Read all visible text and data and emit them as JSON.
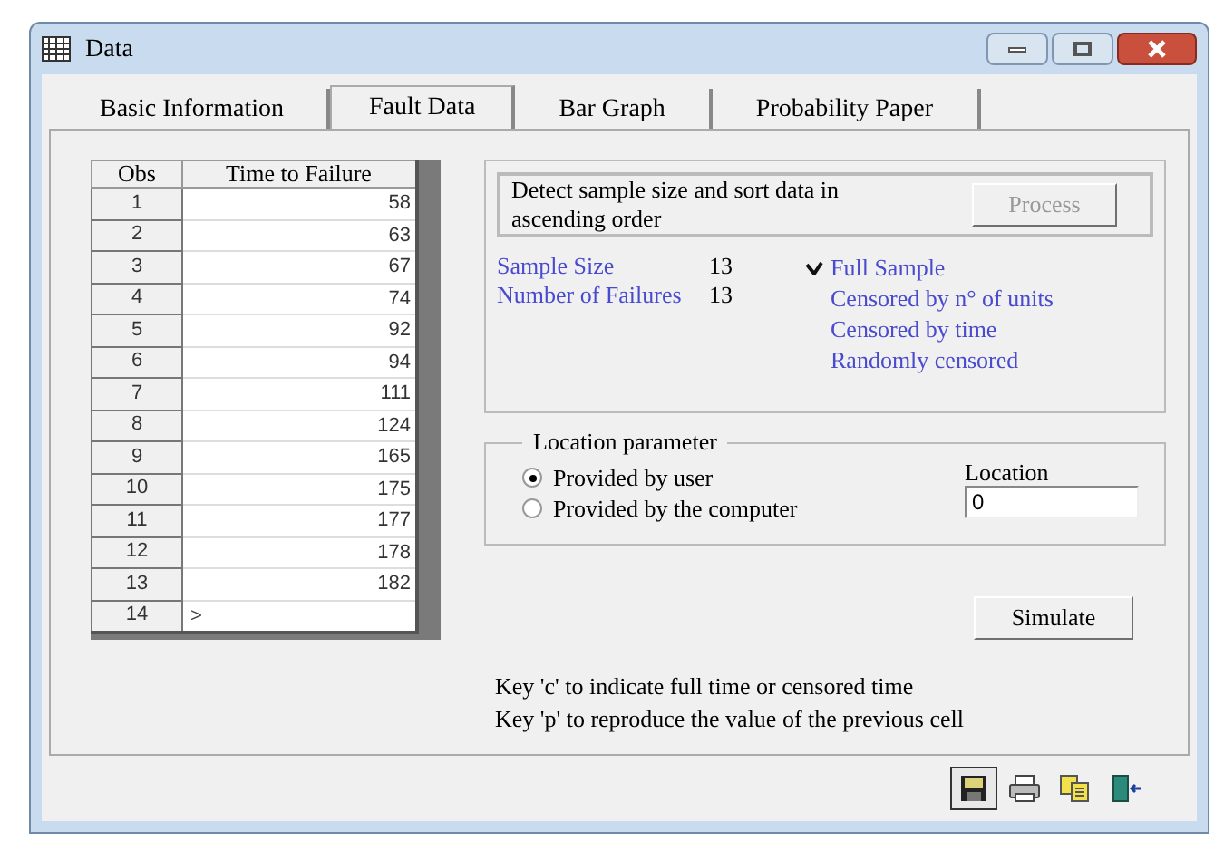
{
  "window": {
    "title": "Data"
  },
  "tabs": [
    {
      "label": "Basic Information",
      "selected": false
    },
    {
      "label": "Fault Data",
      "selected": true
    },
    {
      "label": "Bar Graph",
      "selected": false
    },
    {
      "label": "Probability Paper",
      "selected": false
    }
  ],
  "table": {
    "columns": [
      "Obs",
      "Time to Failure"
    ],
    "rows": [
      [
        "1",
        "58"
      ],
      [
        "2",
        "63"
      ],
      [
        "3",
        "67"
      ],
      [
        "4",
        "74"
      ],
      [
        "5",
        "92"
      ],
      [
        "6",
        "94"
      ],
      [
        "7",
        "111"
      ],
      [
        "8",
        "124"
      ],
      [
        "9",
        "165"
      ],
      [
        "10",
        "175"
      ],
      [
        "11",
        "177"
      ],
      [
        "12",
        "178"
      ],
      [
        "13",
        "182"
      ],
      [
        "14",
        ">"
      ]
    ]
  },
  "process": {
    "text": "Detect sample size and sort data in ascending order",
    "button": "Process"
  },
  "stats": [
    {
      "label": "Sample Size",
      "value": "13"
    },
    {
      "label": "Number of Failures",
      "value": "13"
    }
  ],
  "sample_types": [
    {
      "label": "Full Sample",
      "checked": true
    },
    {
      "label": "Censored by n° of units",
      "checked": false
    },
    {
      "label": "Censored by time",
      "checked": false
    },
    {
      "label": "Randomly censored",
      "checked": false
    }
  ],
  "location": {
    "title": "Location parameter",
    "options": [
      {
        "label": "Provided by user",
        "selected": true
      },
      {
        "label": "Provided by the computer",
        "selected": false
      }
    ],
    "field_label": "Location",
    "value": "0"
  },
  "simulate_button": "Simulate",
  "hints": [
    "Key 'c' to indicate full time or censored time",
    "Key 'p' to reproduce the value of the previous cell"
  ]
}
